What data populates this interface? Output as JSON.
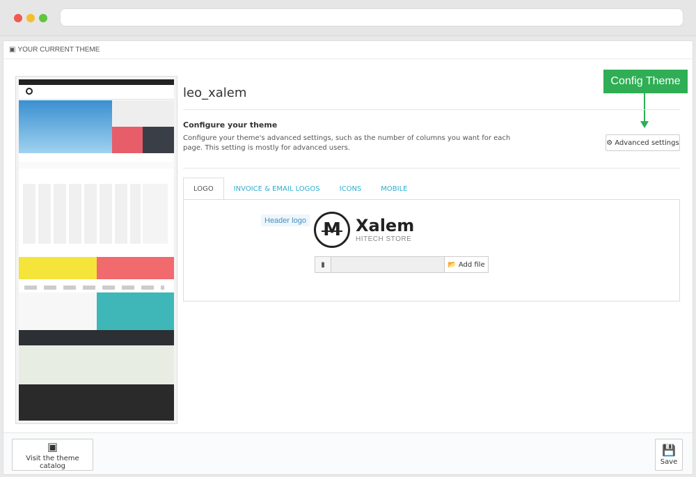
{
  "header": {
    "title": "YOUR CURRENT THEME",
    "icon": "html5-icon"
  },
  "theme": {
    "name": "leo_xalem",
    "configure_title": "Configure your theme",
    "configure_desc": "Configure your theme's advanced settings, such as the number of columns you want for each page. This setting is mostly for advanced users.",
    "advanced_label": "Advanced settings"
  },
  "callout": {
    "label": "Config Theme",
    "color": "#2fae55"
  },
  "tabs": [
    {
      "label": "LOGO",
      "active": true
    },
    {
      "label": "INVOICE & EMAIL LOGOS",
      "active": false
    },
    {
      "label": "ICONS",
      "active": false
    },
    {
      "label": "MOBILE",
      "active": false
    }
  ],
  "logo": {
    "field_label": "Header logo",
    "brand": "Xalem",
    "tagline": "HITECH STORE",
    "letter": "M"
  },
  "upload": {
    "button_label": "Add file"
  },
  "footer": {
    "catalog_label": "Visit the theme catalog",
    "save_label": "Save"
  },
  "colors": {
    "link": "#2eacce",
    "accent": "#2fae55"
  }
}
